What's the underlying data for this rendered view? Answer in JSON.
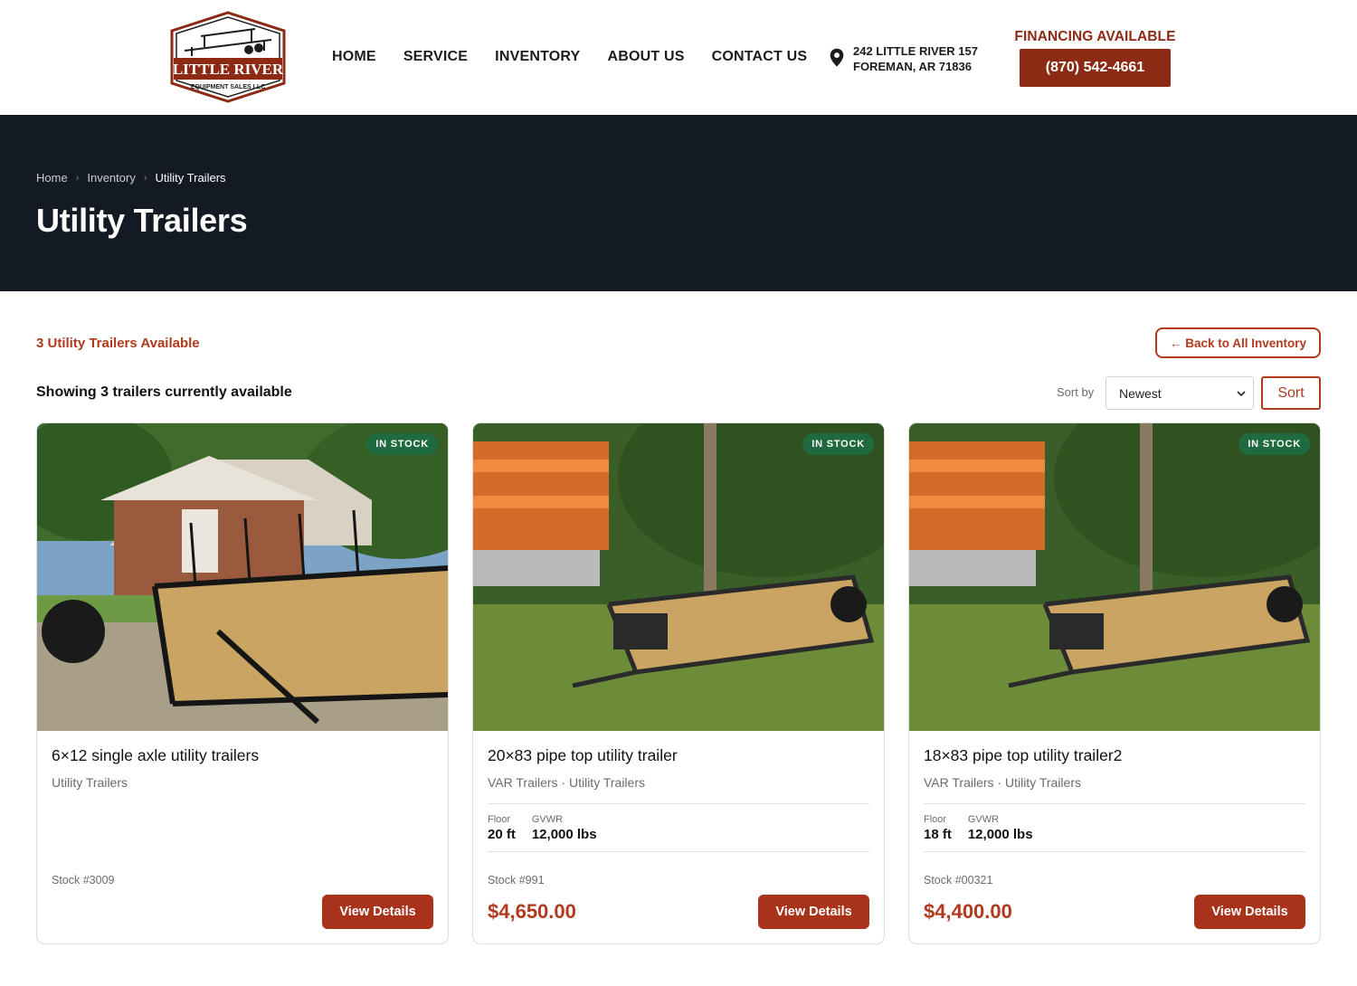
{
  "header": {
    "logo": {
      "line1": "LITTLE RIVER",
      "line2": "EQUIPMENT SALES LLC"
    },
    "nav": [
      "HOME",
      "SERVICE",
      "INVENTORY",
      "ABOUT US",
      "CONTACT US"
    ],
    "address": {
      "icon": "location-pin-icon",
      "line1": "242 LITTLE RIVER 157",
      "line2": "FOREMAN, AR 71836"
    },
    "financing_label": "FINANCING AVAILABLE",
    "phone": "(870) 542-4661"
  },
  "hero": {
    "breadcrumb": [
      "Home",
      "Inventory",
      "Utility Trailers"
    ],
    "title": "Utility Trailers"
  },
  "toolbar": {
    "count_text": "3 Utility Trailers Available",
    "back_label": "← Back to All Inventory",
    "showing_text": "Showing 3 trailers currently available",
    "sort_label": "Sort by",
    "sort_value": "Newest",
    "sort_button": "Sort"
  },
  "cards": [
    {
      "badge": "IN STOCK",
      "title": "6×12 single axle utility trailers",
      "subtitle": "Utility Trailers",
      "specs": [],
      "stock": "Stock #3009",
      "price": "",
      "button": "View Details"
    },
    {
      "badge": "IN STOCK",
      "title": "20×83 pipe top utility trailer",
      "subtitle": "VAR Trailers · Utility Trailers",
      "specs": [
        {
          "label": "Floor",
          "value": "20 ft"
        },
        {
          "label": "GVWR",
          "value": "12,000 lbs"
        }
      ],
      "stock": "Stock #991",
      "price": "$4,650.00",
      "button": "View Details"
    },
    {
      "badge": "IN STOCK",
      "title": "18×83 pipe top utility trailer2",
      "subtitle": "VAR Trailers · Utility Trailers",
      "specs": [
        {
          "label": "Floor",
          "value": "18 ft"
        },
        {
          "label": "GVWR",
          "value": "12,000 lbs"
        }
      ],
      "stock": "Stock #00321",
      "price": "$4,400.00",
      "button": "View Details"
    }
  ],
  "colors": {
    "brand": "#8c2a14",
    "accent": "#b13a1d",
    "hero_bg": "#131a24",
    "badge": "#1f6b3f"
  }
}
